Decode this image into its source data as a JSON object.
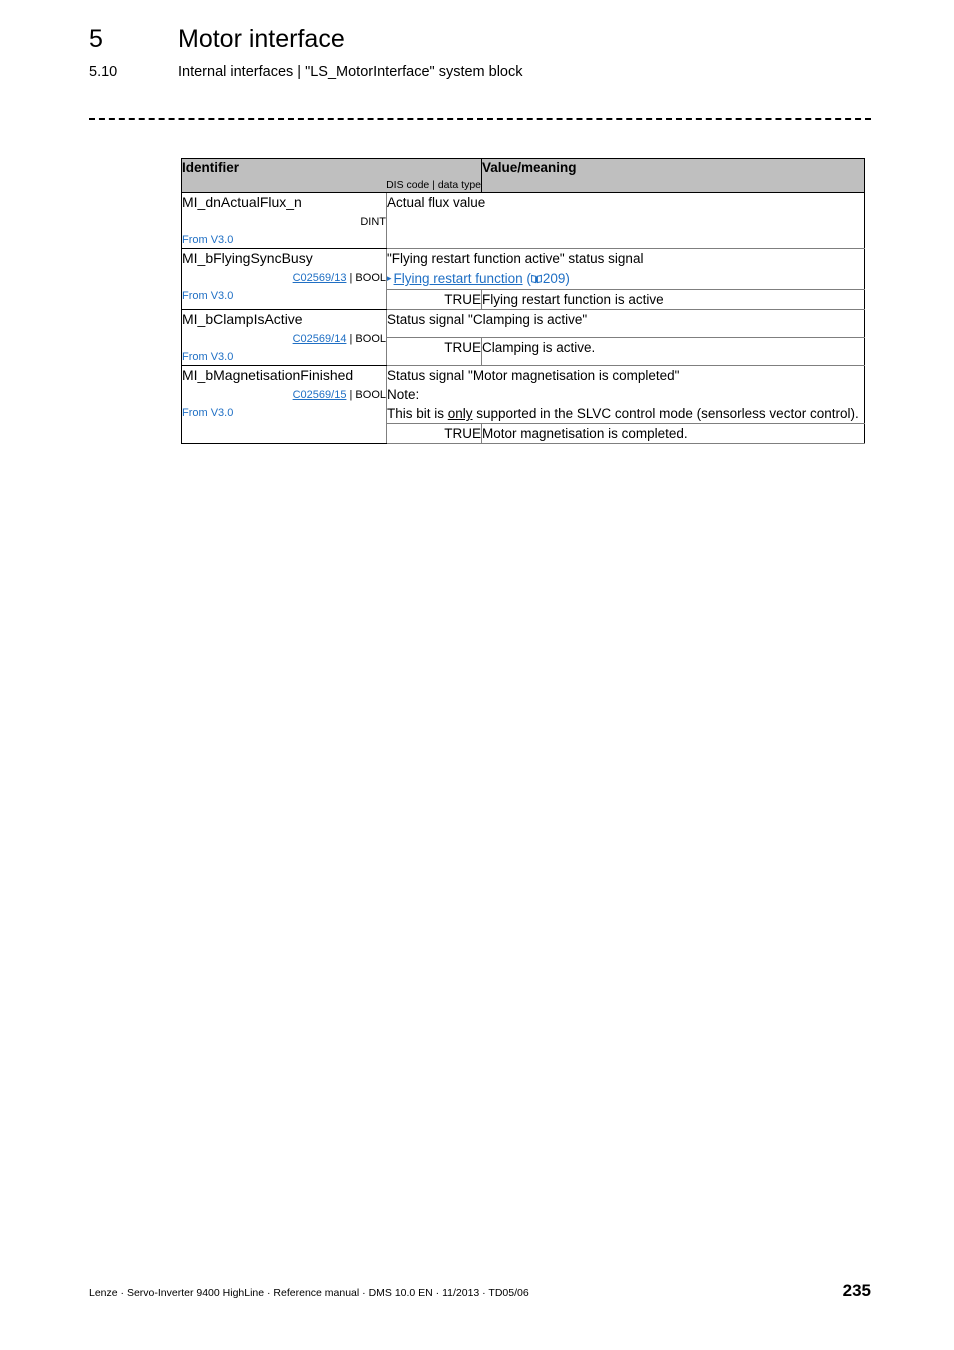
{
  "header": {
    "chapter_number": "5",
    "chapter_title": "Motor interface",
    "section_number": "5.10",
    "section_title": "Internal interfaces | \"LS_MotorInterface\" system block"
  },
  "table": {
    "columns": {
      "identifier_title": "Identifier",
      "identifier_subtitle": "DIS code | data type",
      "value_title": "Value/meaning"
    },
    "rows": [
      {
        "identifier": "MI_dnActualFlux_n",
        "dis_code": "",
        "data_type": "DINT",
        "code_separator": "",
        "from_version": "From V3.0",
        "description": "Actual flux value",
        "link": null,
        "note_lines": [],
        "true_label": "",
        "true_meaning": ""
      },
      {
        "identifier": "MI_bFlyingSyncBusy",
        "dis_code": "C02569/13",
        "code_separator": " | ",
        "data_type": "BOOL",
        "from_version": "From V3.0",
        "description": "\"Flying restart function active\" status signal",
        "link": {
          "bullet": "▸",
          "text": "Flying restart function",
          "page_prefix": "(",
          "book_icon": "book-icon",
          "page_number": "209",
          "page_suffix": ")"
        },
        "note_lines": [],
        "true_label": "TRUE",
        "true_meaning": "Flying restart function is active"
      },
      {
        "identifier": "MI_bClampIsActive",
        "dis_code": "C02569/14",
        "code_separator": " | ",
        "data_type": "BOOL",
        "from_version": "From V3.0",
        "description": "Status signal \"Clamping is active\"",
        "link": null,
        "note_lines": [],
        "true_label": "TRUE",
        "true_meaning": "Clamping is active."
      },
      {
        "identifier": "MI_bMagnetisationFinished",
        "dis_code": "C02569/15",
        "code_separator": " | ",
        "data_type": "BOOL",
        "from_version": "From V3.0",
        "description": "Status signal \"Motor magnetisation is completed\"",
        "link": null,
        "note_lines": [
          "Note:"
        ],
        "note_body_pre": "This bit is ",
        "note_body_emph": "only",
        "note_body_post": " supported in the SLVC control mode (sensorless vector control).",
        "true_label": "TRUE",
        "true_meaning": "Motor magnetisation is completed."
      }
    ]
  },
  "footer": {
    "text": "Lenze · Servo-Inverter 9400 HighLine · Reference manual · DMS 10.0 EN · 11/2013 · TD05/06",
    "page_number": "235"
  },
  "colors": {
    "link": "#1f6fc4",
    "header_fill": "#bfbfbf",
    "text": "#000000"
  }
}
